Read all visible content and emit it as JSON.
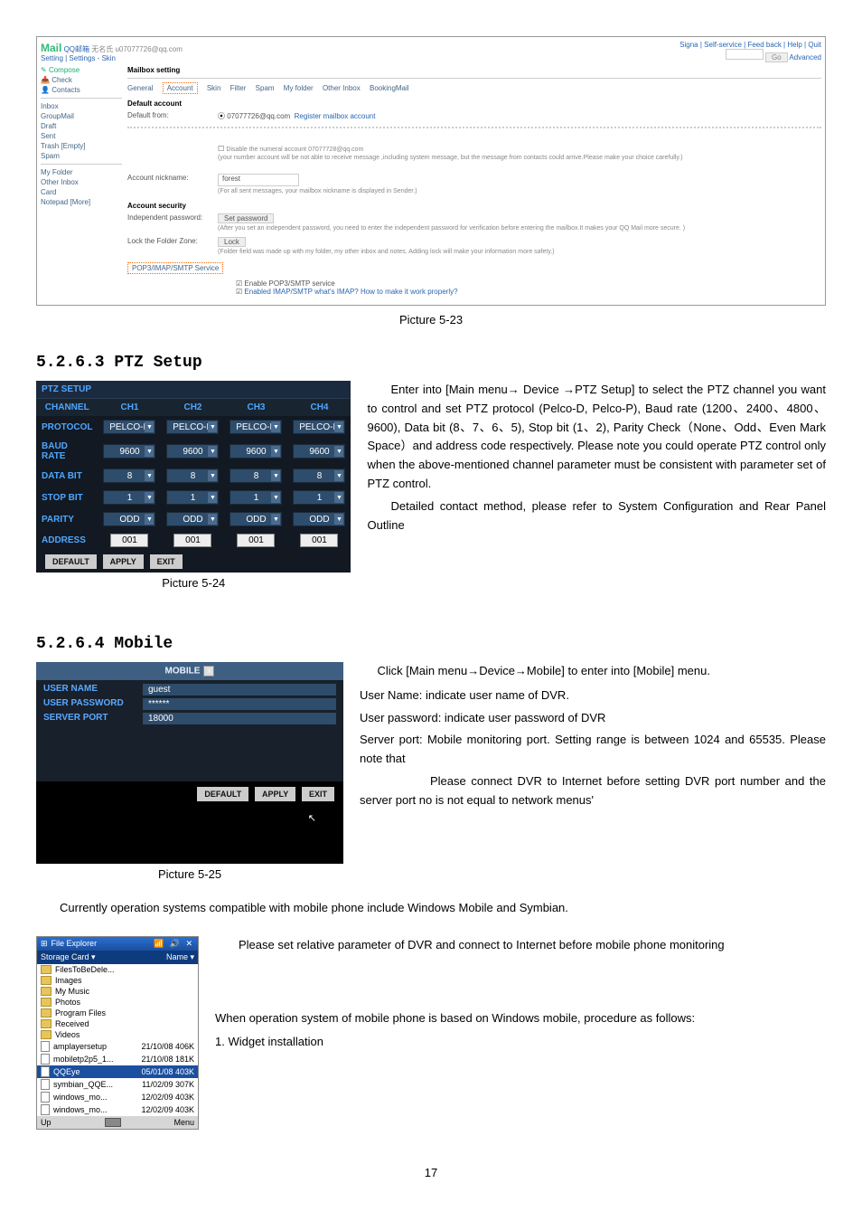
{
  "web": {
    "brand": "Mail",
    "brandCN": "QQ邮箱",
    "account": "无名氏 u07077726@qq.com",
    "crumbs": "Setting | Settings - Skin",
    "topRight": "Signa | Self-service | Feed back | Help | Quit",
    "goBtn": "Go",
    "advanced": "Advanced",
    "sidebar": {
      "compose": "Compose",
      "check": "Check",
      "contacts": "Contacts",
      "inbox": "Inbox",
      "groupmail": "GroupMail",
      "draft": "Draft",
      "sent": "Sent",
      "trash": "Trash",
      "trashEmpty": "[Empty]",
      "spam": "Spam",
      "myfolder": "My Folder",
      "otherInbox": "Other Inbox",
      "card": "Card",
      "notepad": "Notepad",
      "moreLink": "[More]"
    },
    "panelTitle": "Mailbox setting",
    "tabs": {
      "general": "General",
      "account": "Account",
      "skin": "Skin",
      "filter": "Filter",
      "spam": "Spam",
      "myfolder": "My folder",
      "otherInbox": "Other Inbox",
      "bookingMail": "BookingMail"
    },
    "defaultAccount": "Default account",
    "defaultFrom": "Default from:",
    "defaultFromVal": "07077726@qq.com",
    "registerLink": "Register mailbox account",
    "disableHint": "Disable the numeral account 07077728@qq.com",
    "disableNote": "(your number account will be not able to receive message ,including system message, but the message from contacts could arrive.Please make your choice carefully.)",
    "accountNick": "Account nickname:",
    "accountNickVal": "forest",
    "nickHint": "(For all sent messages, your mailbox nickname is displayed in Sender.)",
    "accountSecurity": "Account security",
    "indepPwd": "Independent password:",
    "setPwdBtn": "Set password",
    "indepHint": "(After you set an independent password, you need to enter the independent password for verification before entering the mailbox.It makes your QQ Mail more secure. )",
    "lockZone": "Lock the Folder Zone:",
    "lockBtn": "Lock",
    "lockHint": "(Folder field was made up with my folder, my other inbox and notes. Adding lock will make your information more safety.)",
    "popSvc": "POP3/IMAP/SMTP Service",
    "svcEnable": "Enable POP3/SMTP service",
    "svcEnabled": "Enabled IMAP/SMTP what's IMAP? How to make it work properly?",
    "caption": "Picture 5-23"
  },
  "ptz": {
    "heading": "5.2.6.3 PTZ Setup",
    "title": "PTZ SETUP",
    "cols": [
      "CH1",
      "CH2",
      "CH3",
      "CH4"
    ],
    "rows": {
      "CHANNEL": "CHANNEL",
      "PROTOCOL": "PROTOCOL",
      "BAUD_RATE": "BAUD RATE",
      "DATA_BIT": "DATA BIT",
      "STOP_BIT": "STOP BIT",
      "PARITY": "PARITY",
      "ADDRESS": "ADDRESS"
    },
    "vals": {
      "protocol": "PELCO-D",
      "baud": "9600",
      "databit": "8",
      "stopbit": "1",
      "parity": "ODD",
      "address": "001"
    },
    "btns": {
      "default": "DEFAULT",
      "apply": "APPLY",
      "exit": "EXIT"
    },
    "caption": "Picture 5-24",
    "paraA": "Enter into [Main menu→ Device →PTZ Setup] to select the PTZ channel you want to control and set PTZ protocol (Pelco-D, Pelco-P), Baud rate (1200、2400、4800、9600), Data bit (8、7、6、5), Stop bit (1、2), Parity Check（None、Odd、Even Mark Space）and address code respectively.  Please note you could operate PTZ control only when the above-mentioned channel parameter must be consistent with parameter set of PTZ control.",
    "paraB": "Detailed contact method, please refer to System Configuration and Rear Panel Outline"
  },
  "mobile": {
    "heading": "5.2.6.4 Mobile",
    "title": "MOBILE",
    "rows": {
      "userName": "USER  NAME",
      "userPwd": "USER  PASSWORD",
      "serverPort": "SERVER  PORT"
    },
    "vals": {
      "userName": "guest",
      "userPwd": "******",
      "serverPort": "18000"
    },
    "btns": {
      "default": "DEFAULT",
      "apply": "APPLY",
      "exit": "EXIT"
    },
    "caption": "Picture 5-25",
    "paraA": "Click [Main menu→Device→Mobile] to enter into [Mobile] menu.",
    "paraB": "User Name: indicate user name of DVR.",
    "paraC": "User password: indicate user password of DVR",
    "paraD": "Server port: Mobile monitoring port. Setting range is between 1024 and 65535. Please note that",
    "paraE": "Please connect DVR to Internet before setting DVR port number and the server port no is not equal to network menus'"
  },
  "midPara": "Currently operation systems compatible with mobile phone include Windows Mobile and Symbian.",
  "fe": {
    "title": "File Explorer",
    "storage": "Storage Card",
    "storageR": "Name",
    "items": [
      {
        "name": "FilesToBeDele...",
        "type": "folder"
      },
      {
        "name": "Images",
        "type": "folder"
      },
      {
        "name": "My Music",
        "type": "folder"
      },
      {
        "name": "Photos",
        "type": "folder"
      },
      {
        "name": "Program Files",
        "type": "folder"
      },
      {
        "name": "Received",
        "type": "folder"
      },
      {
        "name": "Videos",
        "type": "folder"
      },
      {
        "name": "amplayersetup",
        "type": "file",
        "date": "21/10/08",
        "size": "406K"
      },
      {
        "name": "mobiletp2p5_1...",
        "type": "file",
        "date": "21/10/08",
        "size": "181K"
      },
      {
        "name": "QQEye",
        "type": "hl",
        "date": "05/01/08",
        "size": "403K"
      },
      {
        "name": "symbian_QQE...",
        "type": "file",
        "date": "11/02/09",
        "size": "307K"
      },
      {
        "name": "windows_mo...",
        "type": "file",
        "date": "12/02/09",
        "size": "403K"
      },
      {
        "name": "windows_mo...",
        "type": "file",
        "date": "12/02/09",
        "size": "403K"
      }
    ],
    "up": "Up",
    "menu": "Menu"
  },
  "right1": "Please set relative parameter of DVR and connect to Internet before mobile phone monitoring",
  "right2": "When operation system of mobile phone is based on Windows mobile, procedure as follows:",
  "right3": "1. Widget installation",
  "pageNum": "17"
}
